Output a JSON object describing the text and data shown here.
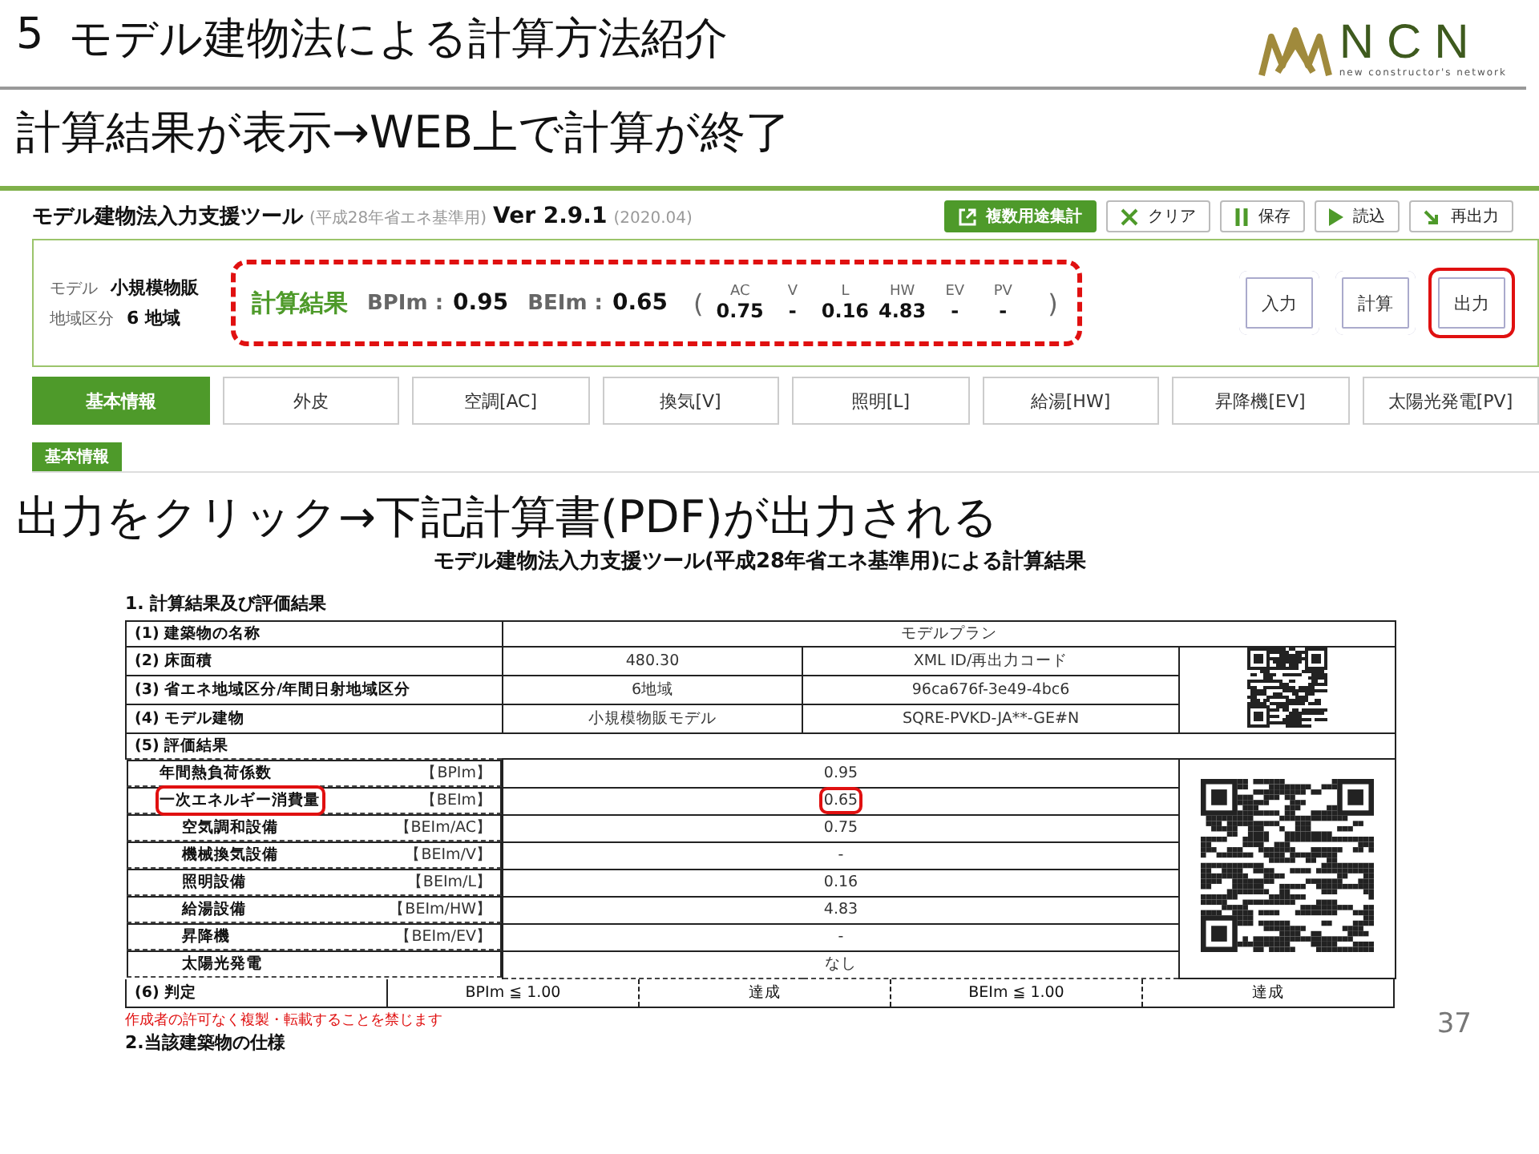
{
  "slide": {
    "number": "5",
    "title": "モデル建物法による計算方法紹介",
    "logo": {
      "letters": "NCN",
      "tagline": "new constructor's network"
    },
    "subtitle": "計算結果が表示→WEB上で計算が終了",
    "step": "出力をクリック→下記計算書(PDF)が出力される",
    "page_number": "37"
  },
  "app": {
    "title": "モデル建物法入力支援ツール",
    "title_note": "(平成28年省エネ基準用)",
    "version": "Ver 2.9.1",
    "date": "(2020.04)",
    "toolbar": [
      {
        "label": "複数用途集計",
        "kind": "primary"
      },
      {
        "label": "クリア",
        "kind": "plain"
      },
      {
        "label": "保存",
        "kind": "plain"
      },
      {
        "label": "読込",
        "kind": "plain"
      },
      {
        "label": "再出力",
        "kind": "plain"
      }
    ],
    "info": [
      {
        "label": "モデル",
        "value": "小規模物販"
      },
      {
        "label": "地域区分",
        "value": "6 地域"
      }
    ],
    "result": {
      "heading": "計算結果",
      "bpi_label": "BPIm :",
      "bpi": "0.95",
      "bei_label": "BEIm :",
      "bei": "0.65",
      "open": "(",
      "close": ")",
      "highlighted": true,
      "breakdown": [
        {
          "label": "AC",
          "value": "0.75"
        },
        {
          "label": "V",
          "value": "-"
        },
        {
          "label": "L",
          "value": "0.16"
        },
        {
          "label": "HW",
          "value": "4.83"
        },
        {
          "label": "EV",
          "value": "-"
        },
        {
          "label": "PV",
          "value": "-"
        }
      ]
    },
    "actions": [
      {
        "label": "入力",
        "highlighted": false
      },
      {
        "label": "計算",
        "highlighted": false
      },
      {
        "label": "出力",
        "highlighted": true
      }
    ],
    "tabs": [
      {
        "label": "基本情報",
        "selected": true
      },
      {
        "label": "外皮",
        "selected": false
      },
      {
        "label": "空調[AC]",
        "selected": false
      },
      {
        "label": "換気[V]",
        "selected": false
      },
      {
        "label": "照明[L]",
        "selected": false
      },
      {
        "label": "給湯[HW]",
        "selected": false
      },
      {
        "label": "昇降機[EV]",
        "selected": false
      },
      {
        "label": "太陽光発電[PV]",
        "selected": false
      }
    ],
    "section_label": "基本情報"
  },
  "report": {
    "title": "モデル建物法入力支援ツール(平成28年省エネ基準用)による計算結果",
    "section": "1. 計算結果及び評価結果",
    "name_row": {
      "label": "(1) 建築物の名称",
      "value": "モデルプラン"
    },
    "info_rows": [
      {
        "label": "(2) 床面積",
        "value": "480.30",
        "code": "XML ID/再出力コード"
      },
      {
        "label": "(3) 省エネ地域区分/年間日射地域区分",
        "value": "6地域",
        "code": "96ca676f-3e49-4bc6"
      },
      {
        "label": "(4) モデル建物",
        "value": "小規模物販モデル",
        "code": "SQRE-PVKD-JA**-GE#N"
      }
    ],
    "eval_heading": "(5) 評価結果",
    "items": [
      {
        "name": "年間熱負荷係数",
        "code": "【BPIm】",
        "value": "0.95",
        "highlighted": false
      },
      {
        "name": "一次エネルギー消費量",
        "code": "【BEIm】",
        "value": "0.65",
        "highlighted": true,
        "children": [
          {
            "name": "空気調和設備",
            "code": "【BEIm/AC】",
            "value": "0.75",
            "highlighted": false
          },
          {
            "name": "機械換気設備",
            "code": "【BEIm/V】",
            "value": "-",
            "highlighted": false
          },
          {
            "name": "照明設備",
            "code": "【BEIm/L】",
            "value": "0.16",
            "highlighted": false
          },
          {
            "name": "給湯設備",
            "code": "【BEIm/HW】",
            "value": "4.83",
            "highlighted": false
          },
          {
            "name": "昇降機",
            "code": "【BEIm/EV】",
            "value": "-",
            "highlighted": false
          },
          {
            "name": "太陽光発電",
            "value": "なし",
            "highlighted": false
          }
        ]
      }
    ],
    "judgement": {
      "label": "(6) 判定",
      "cells": [
        "BPIm ≦ 1.00",
        "達成",
        "BEIm ≦ 1.00",
        "達成"
      ]
    },
    "notice": "作成者の許可なく複製・転載することを禁じます",
    "next_section": "2.当該建築物の仕様"
  }
}
